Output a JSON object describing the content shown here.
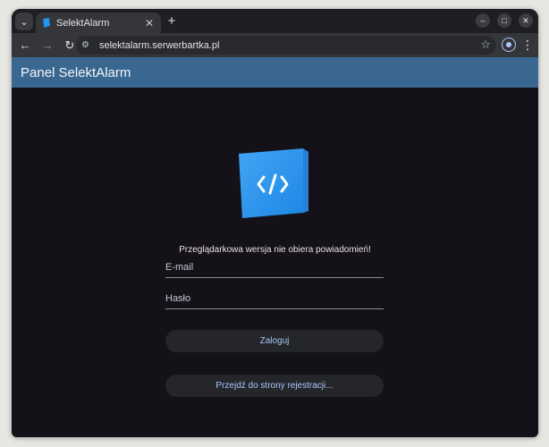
{
  "browser": {
    "tab_title": "SelektAlarm",
    "url": "selektalarm.serwerbartka.pl"
  },
  "app": {
    "title": "Panel SelektAlarm"
  },
  "login": {
    "notice": "Przeglądarkowa wersja nie obiera powiadomień!",
    "email_placeholder": "E-mail",
    "password_placeholder": "Hasło",
    "login_button": "Zaloguj",
    "register_button": "Przejdź do strony rejestracji..."
  },
  "colors": {
    "appbar": "#3a6790",
    "page_background": "#141218",
    "button_text": "#a8c7fa",
    "logo_blue": "#2196f3"
  },
  "icons": {
    "logo": "code-brackets-icon"
  }
}
